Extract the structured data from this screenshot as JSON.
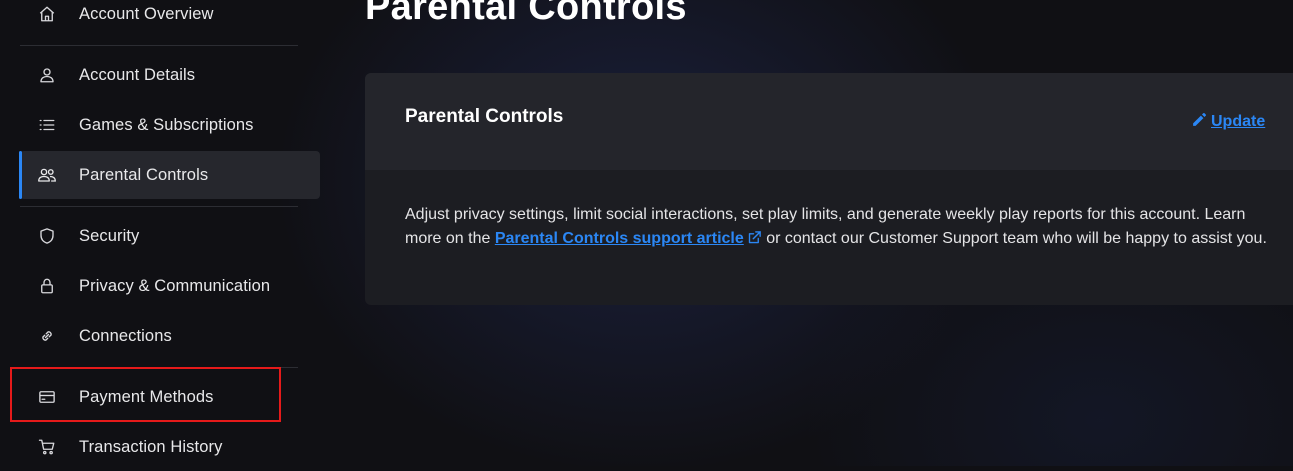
{
  "sidebar": {
    "items": [
      {
        "label": "Account Overview",
        "icon": "home-icon"
      },
      {
        "label": "Account Details",
        "icon": "user-icon"
      },
      {
        "label": "Games & Subscriptions",
        "icon": "list-icon"
      },
      {
        "label": "Parental Controls",
        "icon": "users-icon",
        "active": true
      },
      {
        "label": "Security",
        "icon": "shield-icon"
      },
      {
        "label": "Privacy & Communication",
        "icon": "lock-icon"
      },
      {
        "label": "Connections",
        "icon": "link-icon"
      },
      {
        "label": "Payment Methods",
        "icon": "credit-card-icon",
        "highlighted": true
      },
      {
        "label": "Transaction History",
        "icon": "cart-icon"
      }
    ]
  },
  "main": {
    "page_title": "Parental Controls",
    "card": {
      "title": "Parental Controls",
      "update_label": "Update",
      "body_text_1": "Adjust privacy settings, limit social interactions, set play limits, and generate weekly play reports for this account. Learn more on the ",
      "support_link_label": "Parental Controls support article",
      "body_text_2": " or contact our Customer Support team who will be happy to assist you."
    }
  },
  "colors": {
    "accent": "#2b87f5",
    "highlight_box": "#e51a1a",
    "background": "#101014",
    "card": "#1c1d22"
  }
}
